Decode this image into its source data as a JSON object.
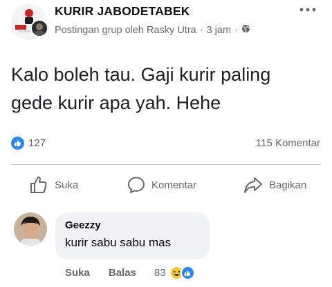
{
  "post": {
    "group_name": "KURIR JABODETABEK",
    "meta_text": "Postingan grup oleh Rasky Utra",
    "time": "3 jam",
    "separator": "·",
    "privacy_icon": "globe-icon",
    "body_line1": "Kalo boleh tau. Gaji kurir paling",
    "body_line2": "gede kurir apa yah. Hehe"
  },
  "stats": {
    "like_count": "127",
    "comment_count": "115 Komentar"
  },
  "actions": {
    "like_label": "Suka",
    "comment_label": "Komentar",
    "share_label": "Bagikan"
  },
  "comment": {
    "author": "Geezzy",
    "text": "kurir sabu sabu mas",
    "like_label": "Suka",
    "reply_label": "Balas",
    "reaction_count": "83"
  },
  "colors": {
    "accent_blue": "#2d87f0",
    "meta_gray": "#65676b",
    "bubble_bg": "#f0f2f5",
    "haha_yellow": "#f7c53c"
  }
}
